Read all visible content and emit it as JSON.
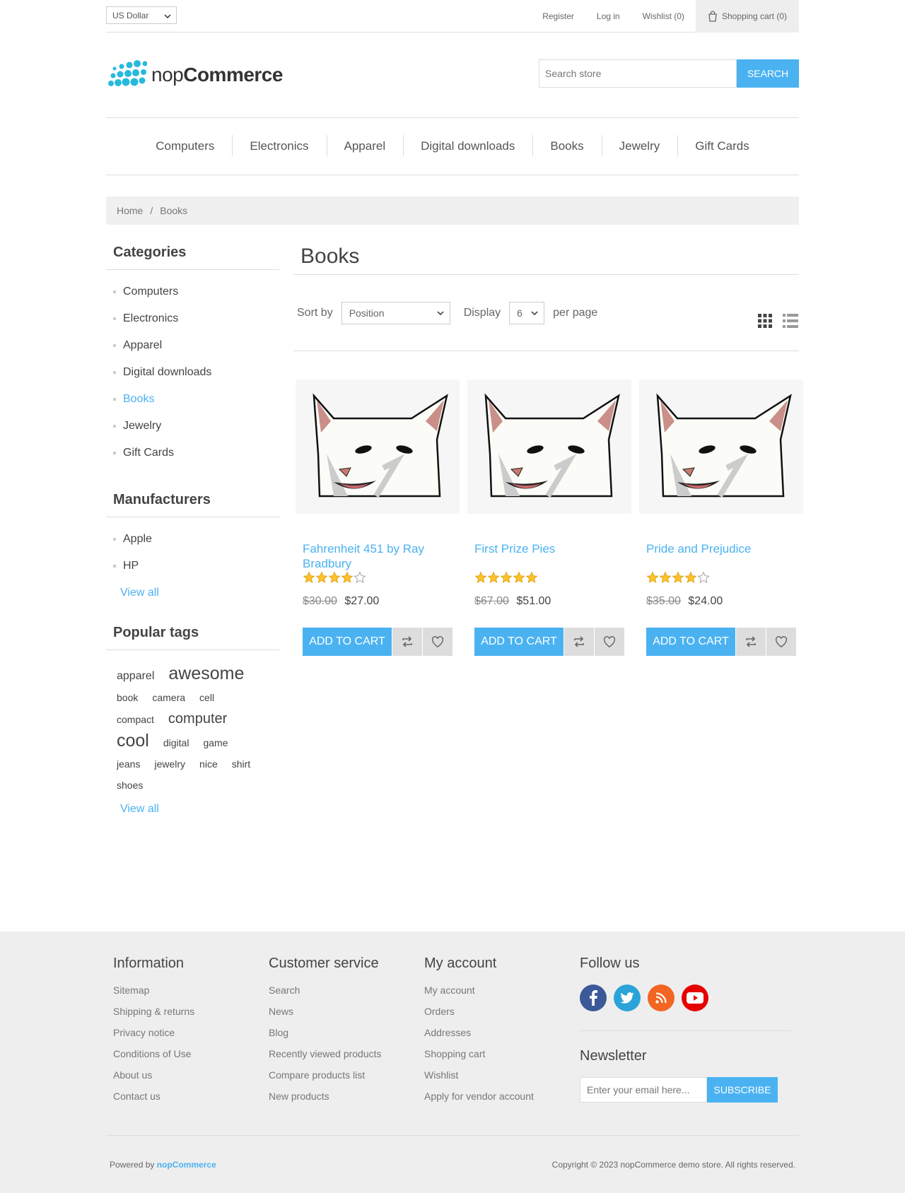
{
  "header": {
    "currency": "US Dollar",
    "register": "Register",
    "login": "Log in",
    "wishlist": "Wishlist (0)",
    "cart": "Shopping cart (0)"
  },
  "logo": {
    "brand_light": "nop",
    "brand_bold": "Commerce"
  },
  "search": {
    "placeholder": "Search store",
    "button": "SEARCH"
  },
  "nav": [
    "Computers",
    "Electronics",
    "Apparel",
    "Digital downloads",
    "Books",
    "Jewelry",
    "Gift Cards"
  ],
  "breadcrumb": {
    "home": "Home",
    "separator": "/",
    "current": "Books"
  },
  "sidebar": {
    "categories_title": "Categories",
    "categories": [
      "Computers",
      "Electronics",
      "Apparel",
      "Digital downloads",
      "Books",
      "Jewelry",
      "Gift Cards"
    ],
    "active_category": "Books",
    "manufacturers_title": "Manufacturers",
    "manufacturers": [
      "Apple",
      "HP"
    ],
    "view_all": "View all",
    "tags_title": "Popular tags",
    "tags": [
      "apparel",
      "awesome",
      "book",
      "camera",
      "cell",
      "compact",
      "computer",
      "cool",
      "digital",
      "game",
      "jeans",
      "jewelry",
      "nice",
      "shirt",
      "shoes"
    ]
  },
  "main": {
    "title": "Books",
    "sort_label": "Sort by",
    "sort_value": "Position",
    "display_label": "Display",
    "display_value": "6",
    "per_page": "per page"
  },
  "products": [
    {
      "name": "Fahrenheit 451 by Ray Bradbury",
      "rating": 4,
      "old_price": "$30.00",
      "price": "$27.00",
      "button": "ADD TO CART"
    },
    {
      "name": "First Prize Pies",
      "rating": 5,
      "old_price": "$67.00",
      "price": "$51.00",
      "button": "ADD TO CART"
    },
    {
      "name": "Pride and Prejudice",
      "rating": 4,
      "old_price": "$35.00",
      "price": "$24.00",
      "button": "ADD TO CART"
    }
  ],
  "footer": {
    "information_title": "Information",
    "information": [
      "Sitemap",
      "Shipping & returns",
      "Privacy notice",
      "Conditions of Use",
      "About us",
      "Contact us"
    ],
    "service_title": "Customer service",
    "service": [
      "Search",
      "News",
      "Blog",
      "Recently viewed products",
      "Compare products list",
      "New products"
    ],
    "account_title": "My account",
    "account": [
      "My account",
      "Orders",
      "Addresses",
      "Shopping cart",
      "Wishlist",
      "Apply for vendor account"
    ],
    "follow_title": "Follow us",
    "newsletter_title": "Newsletter",
    "newsletter_placeholder": "Enter your email here...",
    "subscribe": "SUBSCRIBE",
    "powered_by": "Powered by",
    "powered_brand": "nopCommerce",
    "copyright": "Copyright © 2023 nopCommerce demo store. All rights reserved."
  },
  "colors": {
    "accent": "#4ab2f1",
    "facebook": "#3b5998",
    "twitter": "#1da1f2",
    "rss": "#ff6600",
    "youtube": "#ff0000"
  }
}
